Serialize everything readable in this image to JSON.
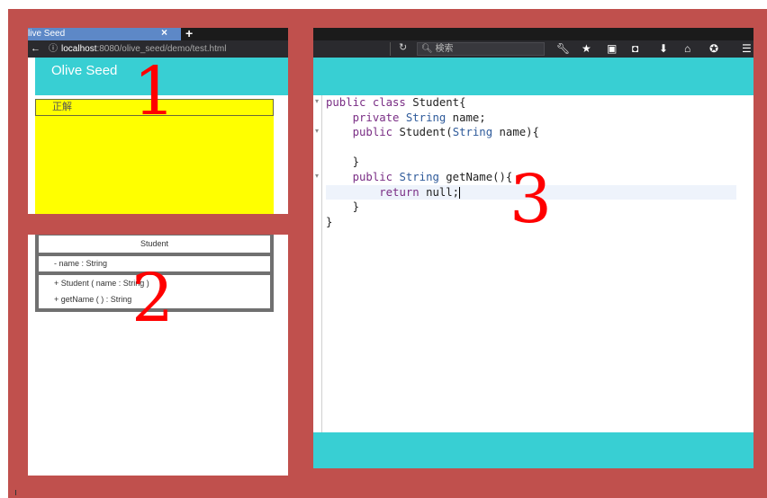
{
  "browser": {
    "tab_title": "live Seed",
    "tab_close": "×",
    "tab_new": "+",
    "url_host": "localhost",
    "url_path": ":8080/olive_seed/demo/test.html",
    "search_placeholder": "検索"
  },
  "app": {
    "title": "Olive Seed"
  },
  "answer": {
    "label": "正解"
  },
  "uml": {
    "class_name": "Student",
    "attributes": [
      "- name : String"
    ],
    "operations": [
      "+ Student ( name : String )",
      "+ getName ( ) : String"
    ]
  },
  "code": {
    "lines": [
      "public class Student{",
      "    private String name;",
      "    public Student(String name){",
      "",
      "    }",
      "    public String getName(){",
      "        return null;",
      "    }",
      "}"
    ],
    "active_line": 6
  },
  "annotations": {
    "n1": "1",
    "n2": "2",
    "n3": "3"
  },
  "colors": {
    "frame": "#c0504d",
    "teal": "#38cfd3",
    "answer": "#ffff00",
    "annotation": "#ff0000"
  }
}
